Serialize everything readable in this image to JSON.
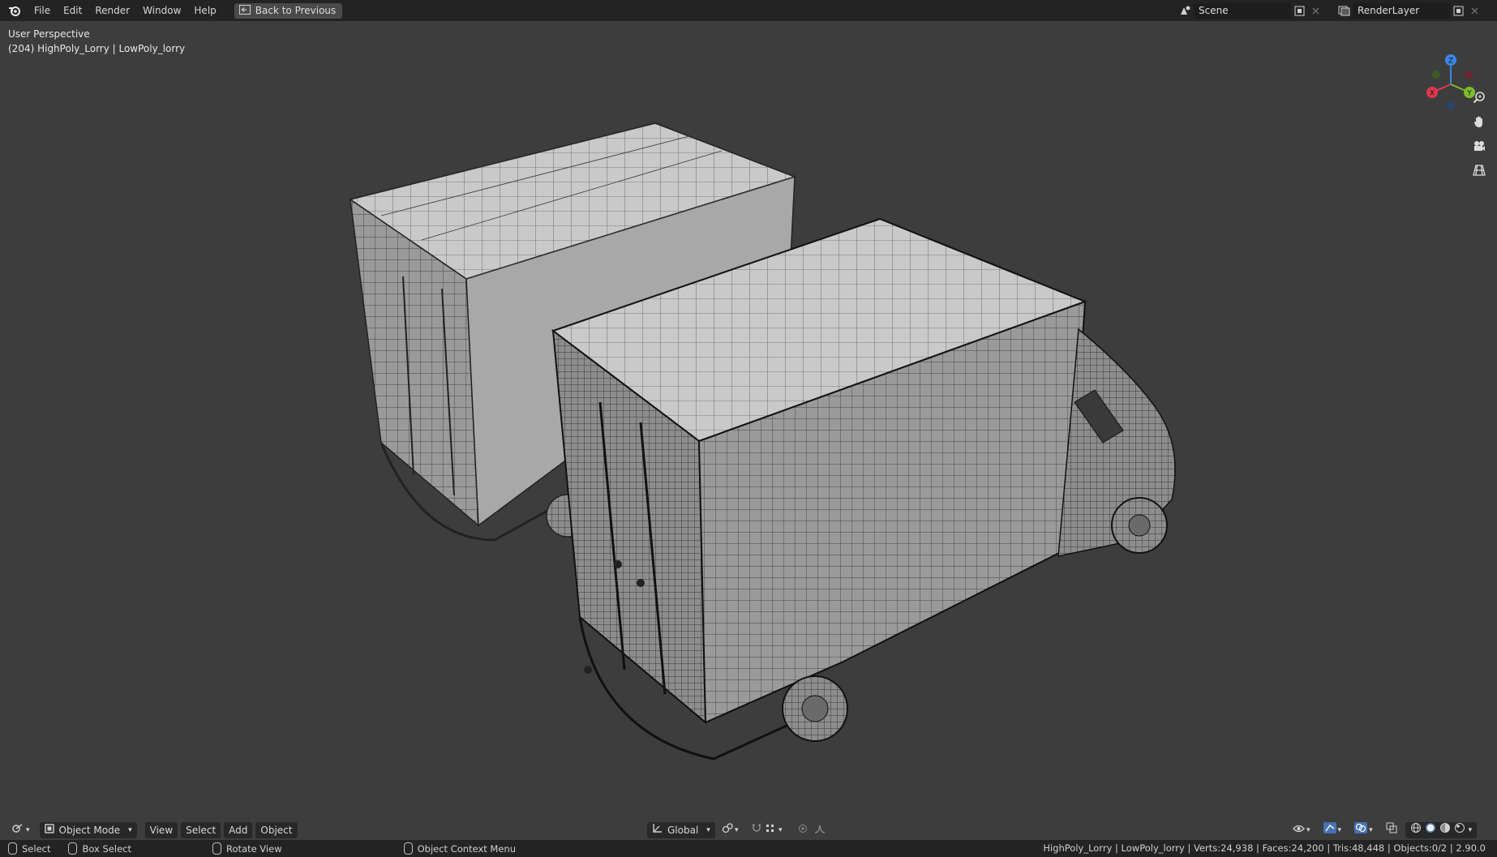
{
  "topbar": {
    "menu": [
      "File",
      "Edit",
      "Render",
      "Window",
      "Help"
    ],
    "back_button": "Back to Previous",
    "scene_name": "Scene",
    "render_layer": "RenderLayer"
  },
  "viewport": {
    "perspective_label": "User Perspective",
    "object_label": "(204) HighPoly_Lorry | LowPoly_lorry",
    "gizmo_axes": [
      "X",
      "Y",
      "Z"
    ]
  },
  "header": {
    "mode": "Object Mode",
    "menus": [
      "View",
      "Select",
      "Add",
      "Object"
    ],
    "orientation": "Global"
  },
  "statusbar": {
    "select": "Select",
    "box_select": "Box Select",
    "rotate_view": "Rotate View",
    "context_menu": "Object Context Menu",
    "stats": "HighPoly_Lorry | LowPoly_lorry | Verts:24,938 | Faces:24,200 | Tris:48,448 | Objects:0/2 | 2.90.0"
  },
  "colors": {
    "viewport_bg": "#3d3d3d",
    "axis_x": "#e0384f",
    "axis_y": "#7cbf2c",
    "axis_z": "#3b86e8"
  }
}
